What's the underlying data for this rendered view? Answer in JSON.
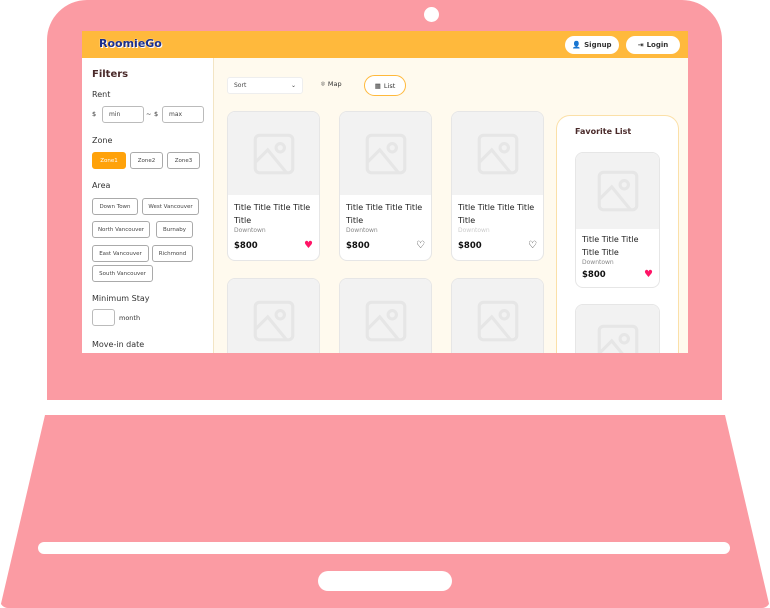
{
  "app": {
    "logo": "RoomieGo",
    "signup": "Signup",
    "login": "Login"
  },
  "filters": {
    "title": "Filters",
    "rent_label": "Rent",
    "currency": "$",
    "min_placeholder": "min",
    "tilde": "~",
    "max_placeholder": "max",
    "zone_label": "Zone",
    "zones": [
      "Zone1",
      "Zone2",
      "Zone3"
    ],
    "selected_zone": "Zone1",
    "area_label": "Area",
    "areas": [
      "Down Town",
      "West Vancouver",
      "North Vancouver",
      "Burnaby",
      "East Vancouver",
      "Richmond",
      "South Vancouver"
    ],
    "min_stay_label": "Minimum Stay",
    "month": "month",
    "move_in_label": "Move-in date"
  },
  "toolbar": {
    "sort": "Sort",
    "map": "Map",
    "list": "List"
  },
  "listings": [
    {
      "title": "Title Title Title Title Title",
      "location": "Downtown",
      "price": "$800",
      "favorited": true
    },
    {
      "title": "Title Title Title Title Title",
      "location": "Downtown",
      "price": "$800",
      "favorited": false
    },
    {
      "title": "Title Title Title Title Title",
      "location": "Downtown",
      "price": "$800",
      "favorited": false
    }
  ],
  "favorites": {
    "title": "Favorite List",
    "items": [
      {
        "title": "Title Title Title Title Title",
        "location": "Downtown",
        "price": "$800"
      }
    ]
  },
  "colors": {
    "accent": "#ffa20a",
    "header": "#ffb93c",
    "laptop": "#fb9ba3",
    "heart": "#ff1466"
  }
}
